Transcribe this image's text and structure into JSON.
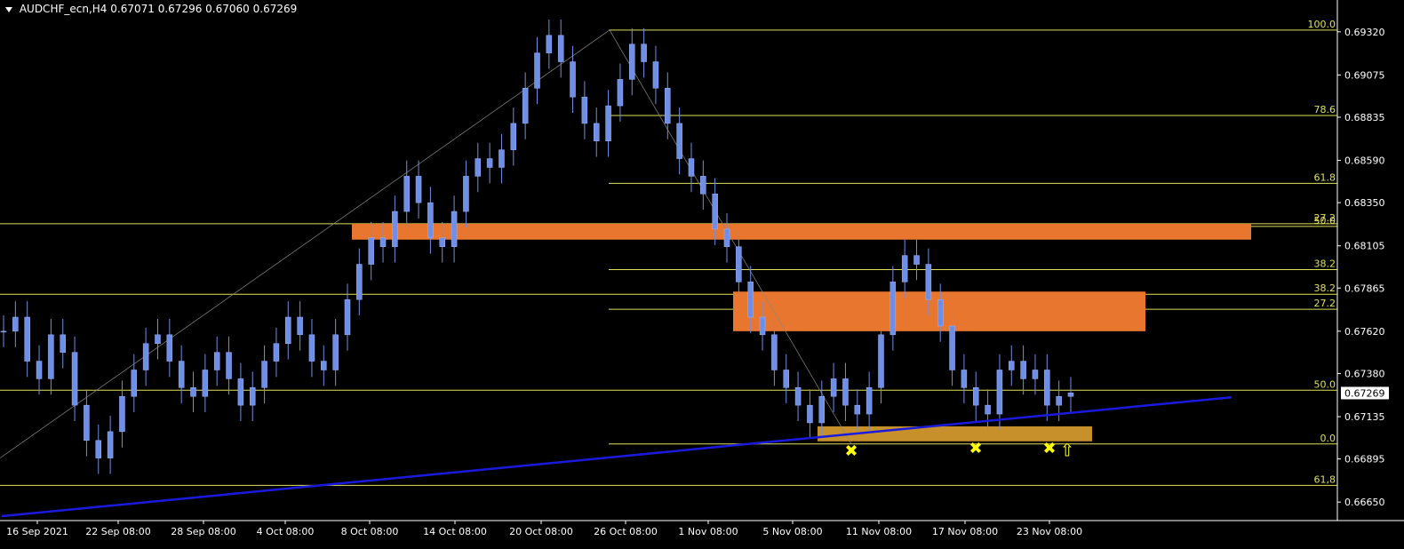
{
  "header": {
    "symbol": "AUDCHF_ecn,H4",
    "open": "0.67071",
    "high": "0.67296",
    "low": "0.67060",
    "close": "0.67269"
  },
  "colors": {
    "background": "#000000",
    "candle": "#6f8fe6",
    "level_line": "#e0e05a",
    "trend_line": "#1a1adf",
    "zone_orange": "#e8762e",
    "zone_gold": "#c8902a",
    "marker": "#ffff00",
    "current_price_box": "#ffffff"
  },
  "chart_data": {
    "type": "candlestick",
    "price_axis": {
      "ticks": [
        "0.69320",
        "0.69075",
        "0.68835",
        "0.68590",
        "0.68350",
        "0.68105",
        "0.67865",
        "0.67620",
        "0.67380",
        "0.67135",
        "0.66895",
        "0.66650"
      ],
      "current": "0.67269",
      "range": [
        0.66545,
        0.6943
      ]
    },
    "time_axis": {
      "labels": [
        "16 Sep 2021",
        "22 Sep 08:00",
        "28 Sep 08:00",
        "4 Oct 08:00",
        "8 Oct 08:00",
        "14 Oct 08:00",
        "20 Oct 08:00",
        "26 Oct 08:00",
        "1 Nov 08:00",
        "5 Nov 08:00",
        "11 Nov 08:00",
        "17 Nov 08:00",
        "23 Nov 08:00"
      ]
    },
    "fib_levels": [
      {
        "label": "100.0",
        "price": 0.6933
      },
      {
        "label": "78.6",
        "price": 0.68845
      },
      {
        "label": "61.8",
        "price": 0.6846
      },
      {
        "label": "50.0",
        "price": 0.68215
      },
      {
        "label": "38.2",
        "price": 0.6797
      },
      {
        "label": "27.2",
        "price": 0.67745
      },
      {
        "label": "0.0",
        "price": 0.6698
      }
    ],
    "extension_levels": [
      {
        "label": "27.2",
        "price": 0.6823
      },
      {
        "label": "38.2",
        "price": 0.6783
      },
      {
        "label": "50.0",
        "price": 0.67285
      },
      {
        "label": "61,8",
        "price": 0.66745
      }
    ],
    "candles_approx": [
      0.6762,
      0.677,
      0.6745,
      0.6735,
      0.676,
      0.675,
      0.672,
      0.67,
      0.669,
      0.6705,
      0.6725,
      0.674,
      0.6755,
      0.676,
      0.6745,
      0.673,
      0.6725,
      0.674,
      0.675,
      0.6735,
      0.672,
      0.673,
      0.6745,
      0.6755,
      0.677,
      0.676,
      0.6745,
      0.674,
      0.676,
      0.678,
      0.68,
      0.6815,
      0.681,
      0.683,
      0.685,
      0.6835,
      0.6815,
      0.681,
      0.683,
      0.685,
      0.686,
      0.6855,
      0.6865,
      0.688,
      0.69,
      0.692,
      0.693,
      0.6915,
      0.6895,
      0.688,
      0.687,
      0.689,
      0.6905,
      0.6925,
      0.6915,
      0.69,
      0.688,
      0.686,
      0.685,
      0.684,
      0.682,
      0.681,
      0.679,
      0.677,
      0.676,
      0.674,
      0.673,
      0.672,
      0.671,
      0.6725,
      0.6735,
      0.672,
      0.6715,
      0.673,
      0.676,
      0.679,
      0.6805,
      0.68,
      0.678,
      0.6765,
      0.674,
      0.673,
      0.672,
      0.6715,
      0.674,
      0.6745,
      0.6735,
      0.674,
      0.672,
      0.6725,
      0.6727
    ]
  }
}
